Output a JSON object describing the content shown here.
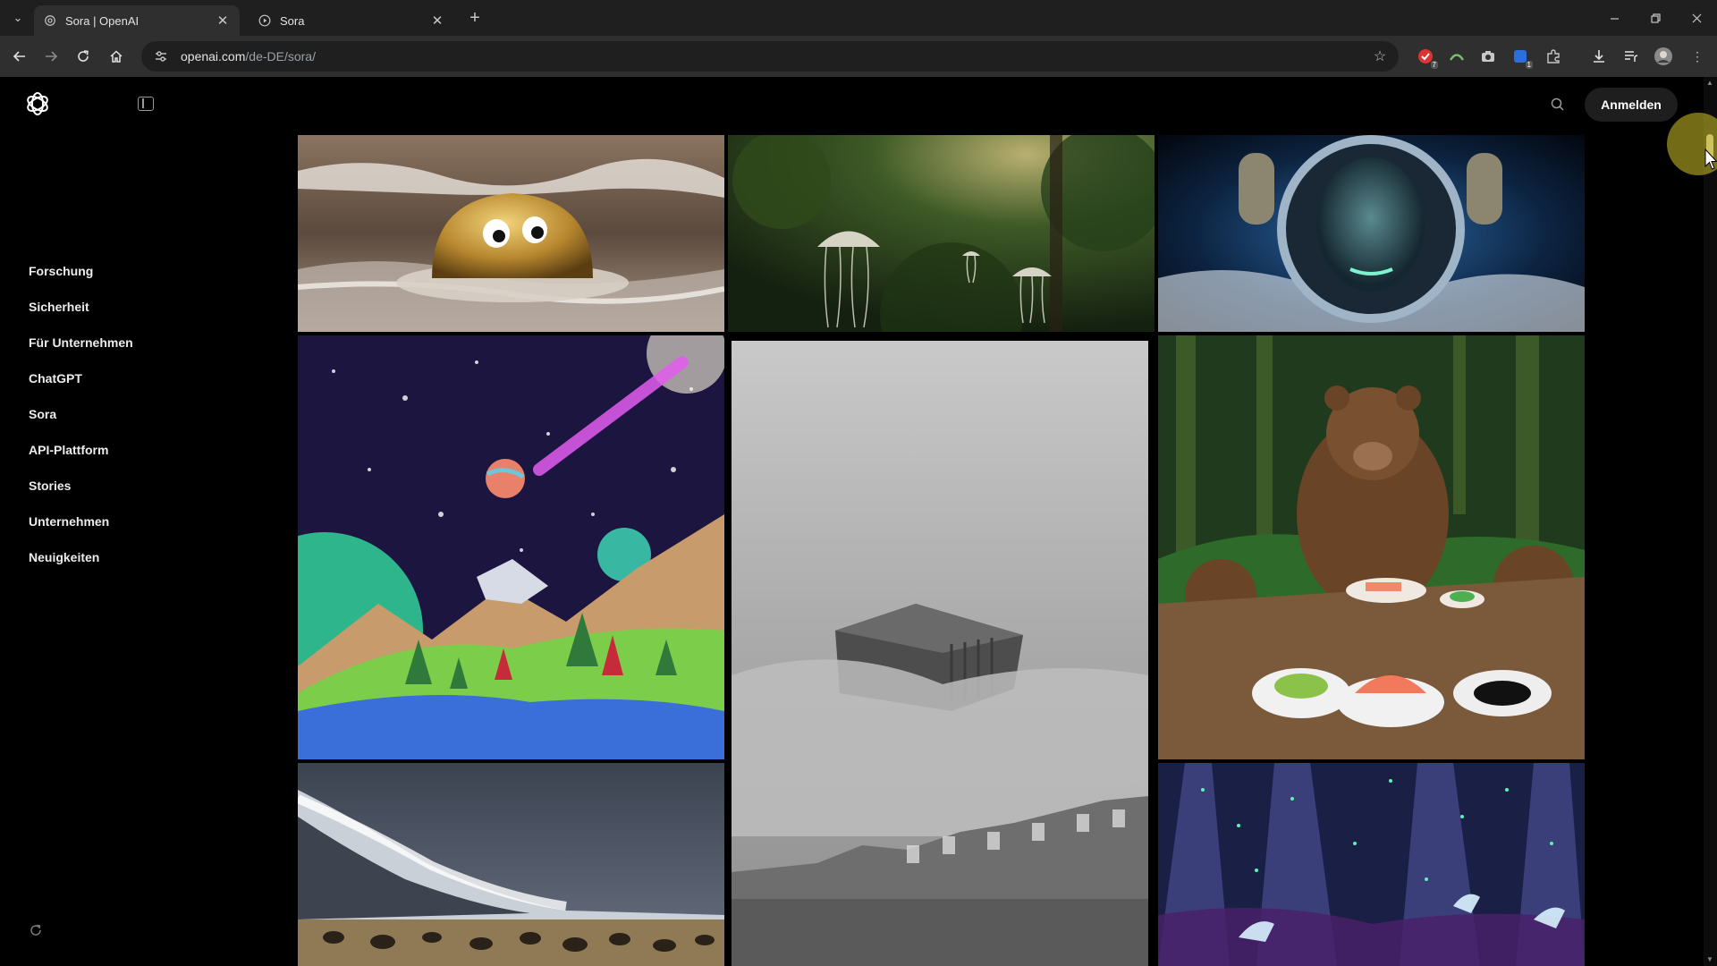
{
  "browser": {
    "tabs": [
      {
        "title": "Sora | OpenAI",
        "active": true
      },
      {
        "title": "Sora",
        "active": false
      }
    ],
    "url_host": "openai.com",
    "url_path": "/de-DE/sora/",
    "extension_badges": [
      "7",
      "1"
    ]
  },
  "header": {
    "login_label": "Anmelden"
  },
  "sidebar": {
    "items": [
      {
        "label": "Forschung"
      },
      {
        "label": "Sicherheit"
      },
      {
        "label": "Für Unternehmen"
      },
      {
        "label": "ChatGPT"
      },
      {
        "label": "Sora"
      },
      {
        "label": "API-Plattform"
      },
      {
        "label": "Stories"
      },
      {
        "label": "Unternehmen"
      },
      {
        "label": "Neuigkeiten"
      }
    ]
  },
  "gallery": {
    "tiles": [
      {
        "name": "gold-blob-on-beach-video"
      },
      {
        "name": "jellyfish-in-forest-video"
      },
      {
        "name": "astronaut-helmet-video"
      },
      {
        "name": "papercraft-space-scene-video"
      },
      {
        "name": "floating-building-in-fog-video"
      },
      {
        "name": "bears-eating-sushi-video"
      },
      {
        "name": "tidal-wave-over-savanna-video"
      },
      {
        "name": "glowing-forest-creatures-video"
      }
    ]
  },
  "colors": {
    "page_background": "#000000",
    "scroll_thumb": "#c9c1a2",
    "cursor_highlight": "#d2c328"
  }
}
